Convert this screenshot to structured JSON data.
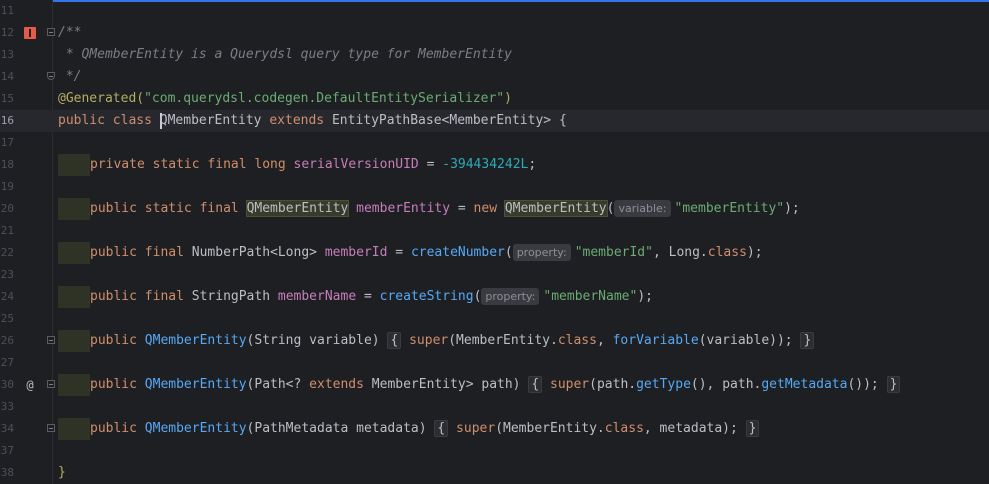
{
  "line_numbers": [
    "11",
    "12",
    "13",
    "14",
    "15",
    "16",
    "17",
    "18",
    "19",
    "20",
    "21",
    "22",
    "23",
    "24",
    "25",
    "26",
    "27",
    "30",
    "33",
    "34",
    "37",
    "38"
  ],
  "icons": {
    "line12": "book-icon",
    "line30": "override-at-icon",
    "fold": "fold-marker-icon"
  },
  "lines": {
    "l12": {
      "a": "/**"
    },
    "l13": {
      "a": " * QMemberEntity is a Querydsl query type for MemberEntity"
    },
    "l14": {
      "a": " */"
    },
    "l15": {
      "a": "@Generated(",
      "b": "\"com.querydsl.codegen.DefaultEntitySerializer\"",
      "c": ")"
    },
    "l16": {
      "kw1": "public",
      "kw2": "class",
      "cls": "QMemberEntity",
      "kw3": "extends",
      "sup": "EntityPathBase<MemberEntity>",
      "br": "{"
    },
    "l18": {
      "k1": "private",
      "k2": "static",
      "k3": "final",
      "k4": "long",
      "f": "serialVersionUID",
      "eq": " = ",
      "n": "-394434242L",
      "end": ";"
    },
    "l20": {
      "k1": "public",
      "k2": "static",
      "k3": "final",
      "t": "QMemberEntity",
      "f": "memberEntity",
      "eq": " = ",
      "k4": "new",
      "c": "QMemberEntity",
      "p": "(",
      "hint": "variable:",
      "s": "\"memberEntity\"",
      "end": ");"
    },
    "l22": {
      "k1": "public",
      "k2": "final",
      "t": "NumberPath<Long>",
      "f": "memberId",
      "eq": " = ",
      "fn": "createNumber",
      "p": "(",
      "hint": "property:",
      "s": "\"memberId\"",
      "mid": ", Long.",
      "k3": "class",
      "end": ");"
    },
    "l24": {
      "k1": "public",
      "k2": "final",
      "t": "StringPath",
      "f": "memberName",
      "eq": " = ",
      "fn": "createString",
      "p": "(",
      "hint": "property:",
      "s": "\"memberName\"",
      "end": ");"
    },
    "l26": {
      "k1": "public",
      "fn": "QMemberEntity",
      "p1": "(String variable) ",
      "ob": "{",
      "k2": "super",
      "m1": "(MemberEntity.",
      "k3": "class",
      "m2": ", ",
      "fn2": "forVariable",
      "m3": "(variable)); ",
      "cb": "}"
    },
    "l30": {
      "k1": "public",
      "fn": "QMemberEntity",
      "p1": "(Path<? ",
      "k2": "extends",
      "p2": " MemberEntity> path) ",
      "ob": "{",
      "k3": "super",
      "m1": "(path.",
      "fn2": "getType",
      "m2": "(), path.",
      "fn3": "getMetadata",
      "m3": "()); ",
      "cb": "}"
    },
    "l34": {
      "k1": "public",
      "fn": "QMemberEntity",
      "p1": "(PathMetadata metadata) ",
      "ob": "{",
      "k2": "super",
      "m1": "(MemberEntity.",
      "k3": "class",
      "m2": ", metadata); ",
      "cb": "}"
    },
    "l38": {
      "a": "}"
    }
  },
  "colors": {
    "background": "#1e1f22",
    "current_line": "#26282e",
    "keyword": "#cf8e6d",
    "field": "#c77dbb",
    "string": "#6aab73",
    "number": "#2aacb8",
    "method": "#56a8f5",
    "annotation": "#b3ae60",
    "comment": "#7a7e85",
    "accent": "#3574f0"
  }
}
